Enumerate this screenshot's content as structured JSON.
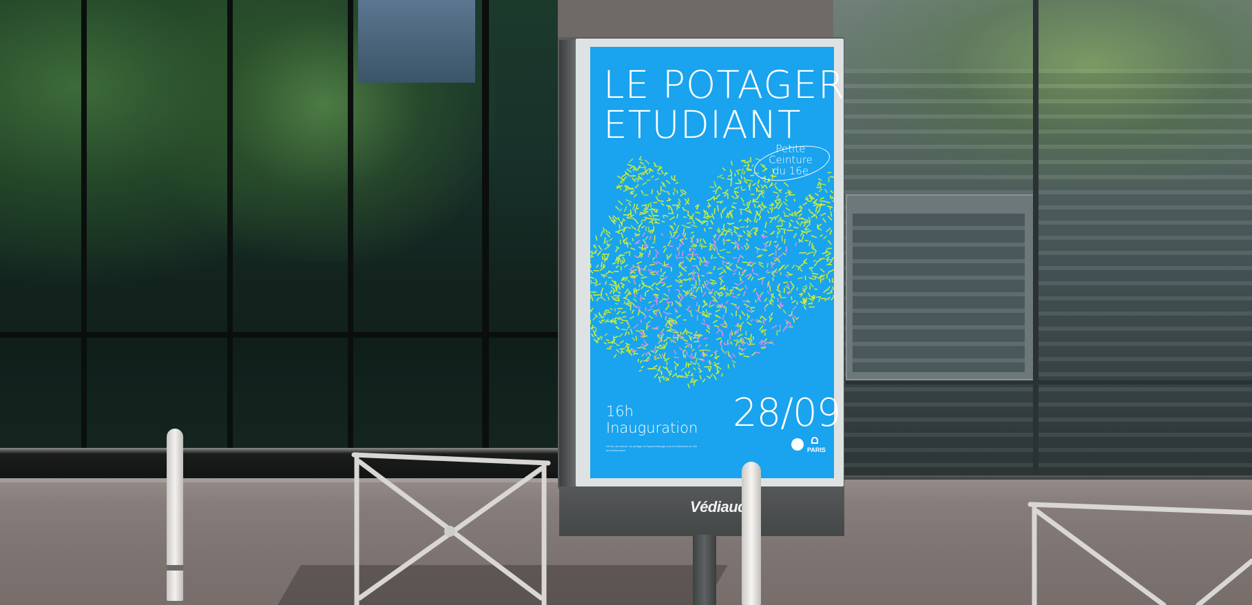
{
  "poster": {
    "title_line1": "LE POTAGER",
    "title_line2": "ETUDIANT",
    "subtitle_line1": "Petite",
    "subtitle_line2": "Ceinture",
    "subtitle_line3": "du 16e",
    "time": "16h",
    "event": "Inauguration",
    "date": "28/09",
    "fine_print": "Un lieu de culture, de partage et d'apprentissage pour les étudiants du 16e arrondissement.",
    "partner_logo_text": "PARIS",
    "background_color": "#1aa3ee",
    "pattern_colors": [
      "#c8ec3a",
      "#d58fe4",
      "#9ee25a"
    ]
  },
  "kiosk": {
    "brand_label": "Védiaud",
    "frame_color": "#d9dcdc",
    "panel_color": "#4a4c4d"
  },
  "scene": {
    "building_glass_color": "#142420",
    "pavement_color": "#7a7372"
  }
}
